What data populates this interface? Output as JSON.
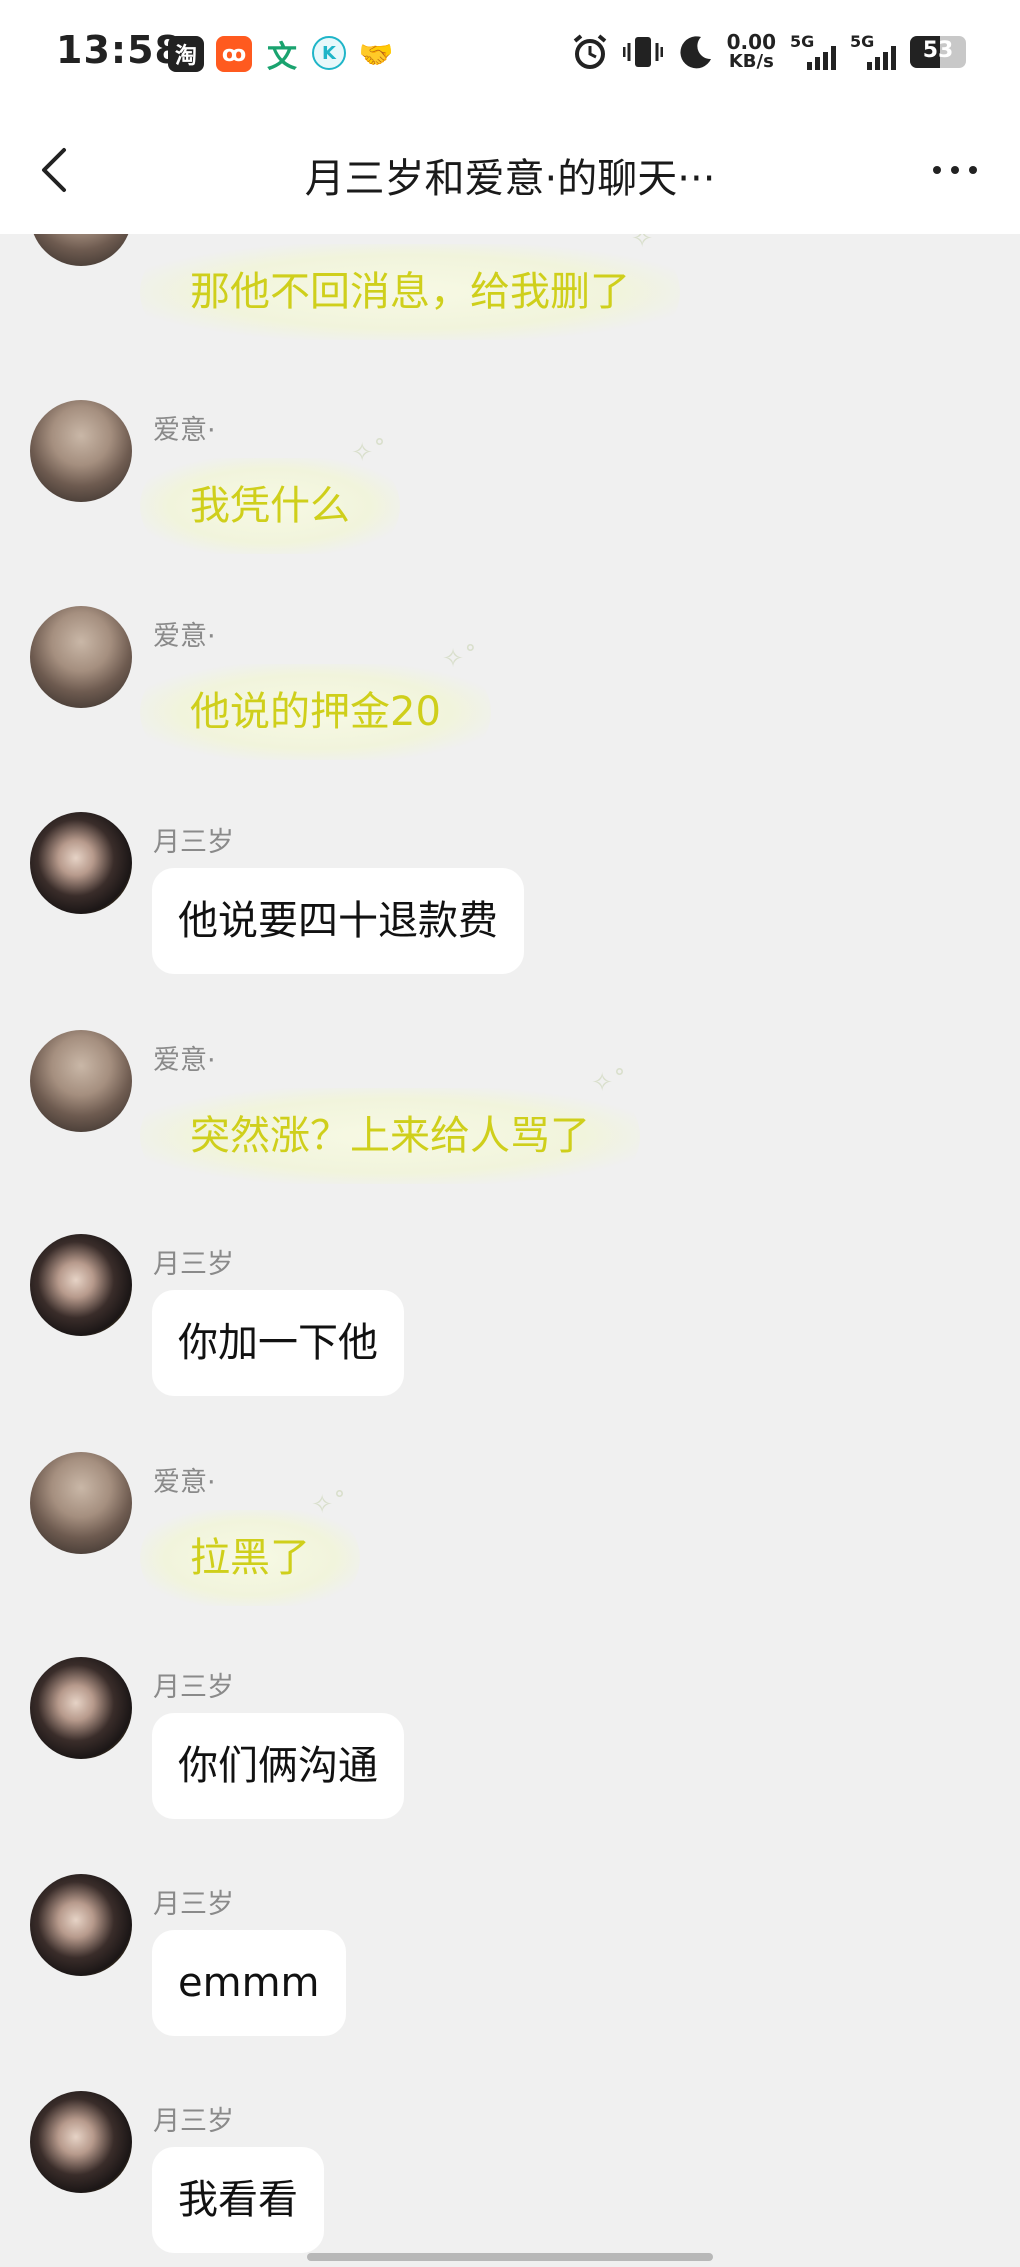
{
  "status_bar": {
    "time": "13:58",
    "app_icons": [
      {
        "icon": "taobao-icon",
        "glyph": "淘"
      },
      {
        "icon": "kuaishou-icon",
        "glyph": "ꝏ"
      },
      {
        "icon": "wen-icon",
        "glyph": "文"
      },
      {
        "icon": "k-icon",
        "glyph": "K"
      },
      {
        "icon": "handshake-icon",
        "glyph": "🤝"
      }
    ],
    "netspeed_value": "0.00",
    "netspeed_unit": "KB/s",
    "signal1_label": "5G",
    "signal2_label": "5G",
    "battery": "53"
  },
  "header": {
    "title": "月三岁和爱意·的聊天···"
  },
  "messages": [
    {
      "sender": "",
      "text": "那他不回消息，给我删了",
      "style": "cloud",
      "avatar": "ai"
    },
    {
      "sender": "爱意·",
      "text": "我凭什么",
      "style": "cloud",
      "avatar": "ai"
    },
    {
      "sender": "爱意·",
      "text": "他说的押金20",
      "style": "cloud",
      "avatar": "ai"
    },
    {
      "sender": "月三岁",
      "text": "他说要四十退款费",
      "style": "plain",
      "avatar": "yue"
    },
    {
      "sender": "爱意·",
      "text": "突然涨？上来给人骂了",
      "style": "cloud",
      "avatar": "ai"
    },
    {
      "sender": "月三岁",
      "text": "你加一下他",
      "style": "plain",
      "avatar": "yue"
    },
    {
      "sender": "爱意·",
      "text": "拉黑了",
      "style": "cloud",
      "avatar": "ai"
    },
    {
      "sender": "月三岁",
      "text": "你们俩沟通",
      "style": "plain",
      "avatar": "yue"
    },
    {
      "sender": "月三岁",
      "text": "emmm",
      "style": "plain",
      "avatar": "yue"
    },
    {
      "sender": "月三岁",
      "text": "我看看",
      "style": "plain",
      "avatar": "yue"
    }
  ]
}
